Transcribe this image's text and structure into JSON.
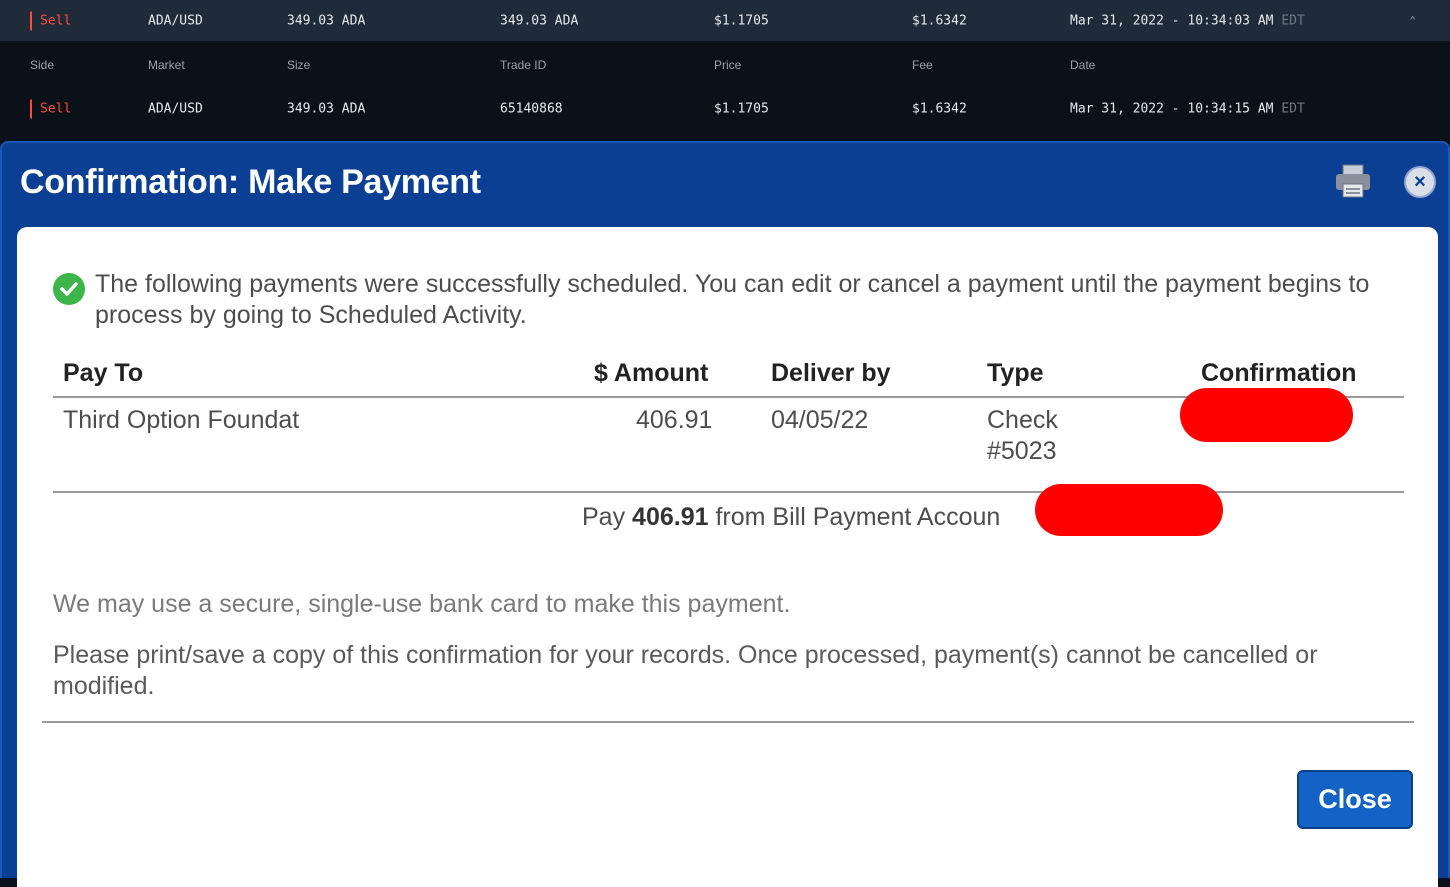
{
  "trades": {
    "top_row": {
      "side": "Sell",
      "market": "ADA/USD",
      "size": "349.03 ADA",
      "trade_id": "349.03 ADA",
      "price": "$1.1705",
      "fee": "$1.6342",
      "date": "Mar 31, 2022 - 10:34:03 AM",
      "tz": "EDT"
    },
    "headers": {
      "side": "Side",
      "market": "Market",
      "size": "Size",
      "trade_id": "Trade ID",
      "price": "Price",
      "fee": "Fee",
      "date": "Date"
    },
    "fill_row": {
      "side": "Sell",
      "market": "ADA/USD",
      "size": "349.03 ADA",
      "trade_id": "65140868",
      "price": "$1.1705",
      "fee": "$1.6342",
      "date": "Mar 31, 2022 - 10:34:15 AM",
      "tz": "EDT"
    },
    "sell_color": "#ff4b3e"
  },
  "modal": {
    "title": "Confirmation: Make Payment",
    "success_message": "The following payments were successfully scheduled. You can edit or cancel a payment until the payment begins to process by going to Scheduled Activity.",
    "table": {
      "headers": {
        "pay_to": "Pay To",
        "amount": "$ Amount",
        "deliver_by": "Deliver by",
        "type": "Type",
        "confirmation": "Confirmation"
      },
      "row": {
        "pay_to": "Third Option Foundat",
        "amount": "406.91",
        "deliver_by": "04/05/22",
        "type_line1": "Check",
        "type_line2": "#5023"
      }
    },
    "pay_summary": {
      "prefix": "Pay",
      "amount": "406.91",
      "suffix": "from Bill Payment Accoun"
    },
    "note_card": "We may use a secure, single-use bank card to make this payment.",
    "note_print": "Please print/save a copy of this confirmation for your records. Once processed, payment(s) cannot be cancelled or modified.",
    "close_label": "Close",
    "close_x": "×",
    "colors": {
      "header_bg": "#0a3f94",
      "button_bg": "#1363c6",
      "success_green": "#3db54a",
      "redaction": "#ff0000"
    }
  }
}
